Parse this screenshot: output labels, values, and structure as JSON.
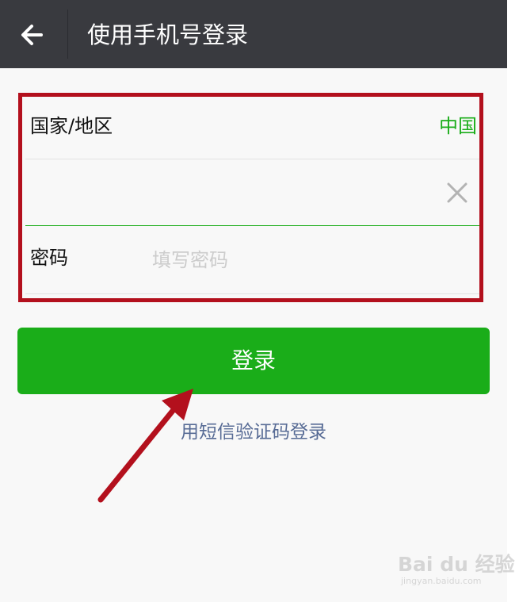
{
  "header": {
    "title": "使用手机号登录",
    "back_icon": "back-arrow-icon",
    "background": "#393a3f"
  },
  "form": {
    "region": {
      "label": "国家/地区",
      "value": "中国"
    },
    "phone": {
      "value": "",
      "clear_icon": "clear-x-icon"
    },
    "password": {
      "label": "密码",
      "placeholder": "填写密码"
    }
  },
  "login_button": {
    "label": "登录",
    "color": "#1aad19"
  },
  "sms_login_link": "用短信验证码登录",
  "annotation": {
    "box_color": "#b3101d",
    "arrow_color": "#b3101d"
  },
  "watermark": {
    "brand": "Bai du 经验",
    "url": "jingyan.baidu.com"
  },
  "colors": {
    "accent": "#1aad19",
    "link": "#576b95"
  }
}
